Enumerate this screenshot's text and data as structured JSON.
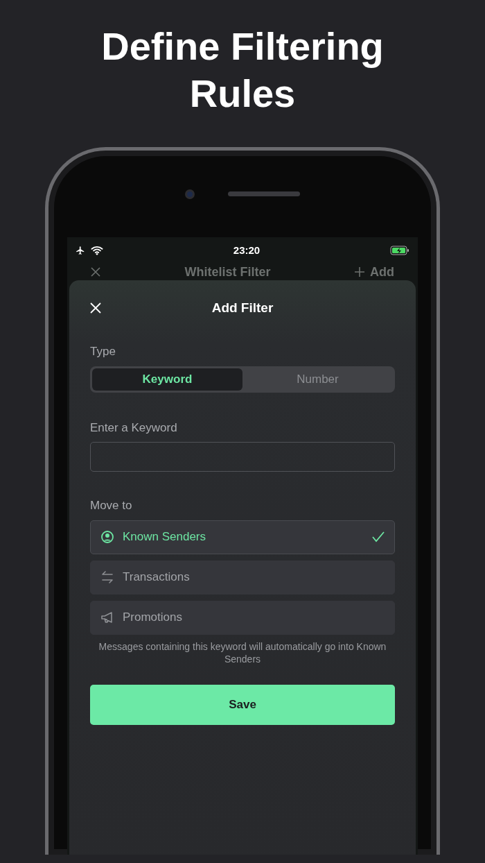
{
  "headline": "Define Filtering Rules",
  "status_bar": {
    "time": "23:20"
  },
  "background_nav": {
    "title": "Whitelist Filter",
    "action": "Add"
  },
  "sheet": {
    "title": "Add Filter",
    "type_label": "Type",
    "type_options": [
      {
        "label": "Keyword",
        "selected": true
      },
      {
        "label": "Number",
        "selected": false
      }
    ],
    "keyword_label": "Enter a Keyword",
    "move_label": "Move to",
    "destinations": [
      {
        "kind": "person",
        "label": "Known Senders",
        "selected": true
      },
      {
        "kind": "transfer",
        "label": "Transactions",
        "selected": false
      },
      {
        "kind": "megaphone",
        "label": "Promotions",
        "selected": false
      }
    ],
    "note": "Messages containing this keyword will automatically go into Known Senders",
    "save": "Save"
  }
}
